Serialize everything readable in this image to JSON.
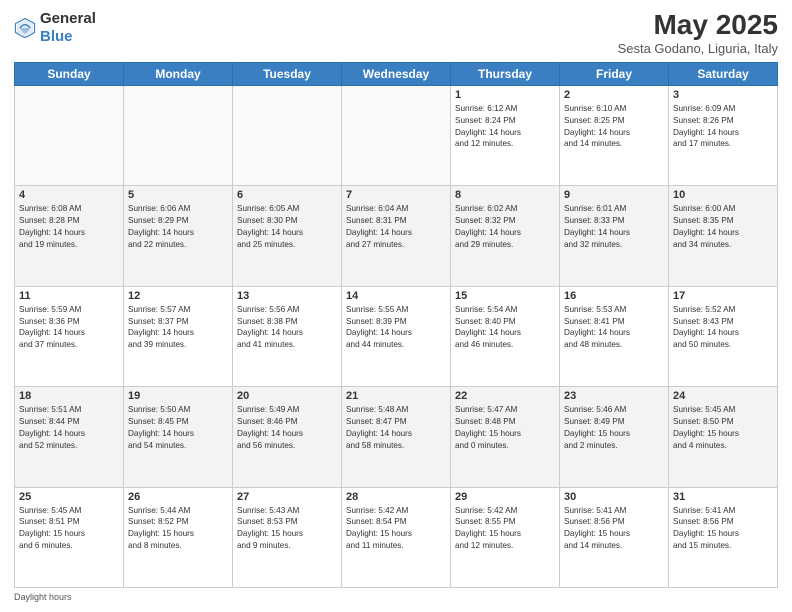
{
  "header": {
    "logo_general": "General",
    "logo_blue": "Blue",
    "month_title": "May 2025",
    "subtitle": "Sesta Godano, Liguria, Italy"
  },
  "days_of_week": [
    "Sunday",
    "Monday",
    "Tuesday",
    "Wednesday",
    "Thursday",
    "Friday",
    "Saturday"
  ],
  "footer_text": "Daylight hours",
  "weeks": [
    [
      {
        "day": "",
        "info": ""
      },
      {
        "day": "",
        "info": ""
      },
      {
        "day": "",
        "info": ""
      },
      {
        "day": "",
        "info": ""
      },
      {
        "day": "1",
        "info": "Sunrise: 6:12 AM\nSunset: 8:24 PM\nDaylight: 14 hours\nand 12 minutes."
      },
      {
        "day": "2",
        "info": "Sunrise: 6:10 AM\nSunset: 8:25 PM\nDaylight: 14 hours\nand 14 minutes."
      },
      {
        "day": "3",
        "info": "Sunrise: 6:09 AM\nSunset: 8:26 PM\nDaylight: 14 hours\nand 17 minutes."
      }
    ],
    [
      {
        "day": "4",
        "info": "Sunrise: 6:08 AM\nSunset: 8:28 PM\nDaylight: 14 hours\nand 19 minutes."
      },
      {
        "day": "5",
        "info": "Sunrise: 6:06 AM\nSunset: 8:29 PM\nDaylight: 14 hours\nand 22 minutes."
      },
      {
        "day": "6",
        "info": "Sunrise: 6:05 AM\nSunset: 8:30 PM\nDaylight: 14 hours\nand 25 minutes."
      },
      {
        "day": "7",
        "info": "Sunrise: 6:04 AM\nSunset: 8:31 PM\nDaylight: 14 hours\nand 27 minutes."
      },
      {
        "day": "8",
        "info": "Sunrise: 6:02 AM\nSunset: 8:32 PM\nDaylight: 14 hours\nand 29 minutes."
      },
      {
        "day": "9",
        "info": "Sunrise: 6:01 AM\nSunset: 8:33 PM\nDaylight: 14 hours\nand 32 minutes."
      },
      {
        "day": "10",
        "info": "Sunrise: 6:00 AM\nSunset: 8:35 PM\nDaylight: 14 hours\nand 34 minutes."
      }
    ],
    [
      {
        "day": "11",
        "info": "Sunrise: 5:59 AM\nSunset: 8:36 PM\nDaylight: 14 hours\nand 37 minutes."
      },
      {
        "day": "12",
        "info": "Sunrise: 5:57 AM\nSunset: 8:37 PM\nDaylight: 14 hours\nand 39 minutes."
      },
      {
        "day": "13",
        "info": "Sunrise: 5:56 AM\nSunset: 8:38 PM\nDaylight: 14 hours\nand 41 minutes."
      },
      {
        "day": "14",
        "info": "Sunrise: 5:55 AM\nSunset: 8:39 PM\nDaylight: 14 hours\nand 44 minutes."
      },
      {
        "day": "15",
        "info": "Sunrise: 5:54 AM\nSunset: 8:40 PM\nDaylight: 14 hours\nand 46 minutes."
      },
      {
        "day": "16",
        "info": "Sunrise: 5:53 AM\nSunset: 8:41 PM\nDaylight: 14 hours\nand 48 minutes."
      },
      {
        "day": "17",
        "info": "Sunrise: 5:52 AM\nSunset: 8:43 PM\nDaylight: 14 hours\nand 50 minutes."
      }
    ],
    [
      {
        "day": "18",
        "info": "Sunrise: 5:51 AM\nSunset: 8:44 PM\nDaylight: 14 hours\nand 52 minutes."
      },
      {
        "day": "19",
        "info": "Sunrise: 5:50 AM\nSunset: 8:45 PM\nDaylight: 14 hours\nand 54 minutes."
      },
      {
        "day": "20",
        "info": "Sunrise: 5:49 AM\nSunset: 8:46 PM\nDaylight: 14 hours\nand 56 minutes."
      },
      {
        "day": "21",
        "info": "Sunrise: 5:48 AM\nSunset: 8:47 PM\nDaylight: 14 hours\nand 58 minutes."
      },
      {
        "day": "22",
        "info": "Sunrise: 5:47 AM\nSunset: 8:48 PM\nDaylight: 15 hours\nand 0 minutes."
      },
      {
        "day": "23",
        "info": "Sunrise: 5:46 AM\nSunset: 8:49 PM\nDaylight: 15 hours\nand 2 minutes."
      },
      {
        "day": "24",
        "info": "Sunrise: 5:45 AM\nSunset: 8:50 PM\nDaylight: 15 hours\nand 4 minutes."
      }
    ],
    [
      {
        "day": "25",
        "info": "Sunrise: 5:45 AM\nSunset: 8:51 PM\nDaylight: 15 hours\nand 6 minutes."
      },
      {
        "day": "26",
        "info": "Sunrise: 5:44 AM\nSunset: 8:52 PM\nDaylight: 15 hours\nand 8 minutes."
      },
      {
        "day": "27",
        "info": "Sunrise: 5:43 AM\nSunset: 8:53 PM\nDaylight: 15 hours\nand 9 minutes."
      },
      {
        "day": "28",
        "info": "Sunrise: 5:42 AM\nSunset: 8:54 PM\nDaylight: 15 hours\nand 11 minutes."
      },
      {
        "day": "29",
        "info": "Sunrise: 5:42 AM\nSunset: 8:55 PM\nDaylight: 15 hours\nand 12 minutes."
      },
      {
        "day": "30",
        "info": "Sunrise: 5:41 AM\nSunset: 8:56 PM\nDaylight: 15 hours\nand 14 minutes."
      },
      {
        "day": "31",
        "info": "Sunrise: 5:41 AM\nSunset: 8:56 PM\nDaylight: 15 hours\nand 15 minutes."
      }
    ]
  ]
}
